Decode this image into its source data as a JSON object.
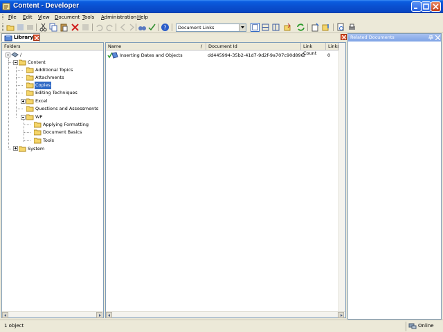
{
  "window": {
    "title": "Content - Developer"
  },
  "menu": [
    "File",
    "Edit",
    "View",
    "Document",
    "Tools",
    "Administration",
    "Help"
  ],
  "toolbar": {
    "document_links_select": "Document Links"
  },
  "library_tab": {
    "label": "Library"
  },
  "folders": {
    "header": "Folders",
    "tree": [
      {
        "label": "/",
        "level": 0
      },
      {
        "label": "Content",
        "level": 1
      },
      {
        "label": "Additional Topics",
        "level": 2
      },
      {
        "label": "Attachments",
        "level": 2
      },
      {
        "label": "Copies",
        "level": 2,
        "selected": true
      },
      {
        "label": "Editing Techniques",
        "level": 2
      },
      {
        "label": "Excel",
        "level": 2
      },
      {
        "label": "Questions and Assessments",
        "level": 2
      },
      {
        "label": "WP",
        "level": 2
      },
      {
        "label": "Applying Formatting",
        "level": 3
      },
      {
        "label": "Document Basics",
        "level": 3
      },
      {
        "label": "Tools",
        "level": 3
      },
      {
        "label": "System",
        "level": 1
      }
    ]
  },
  "documents": {
    "columns": [
      "Name",
      "Document Id",
      "Link Count",
      "Links"
    ],
    "rows": [
      {
        "name": "Inserting Dates and Objects",
        "id": "dd445994-35b2-41d7-9d2f-9a707c90d896",
        "link_count": "3",
        "links": "0"
      }
    ]
  },
  "related": {
    "title": "Related Documents"
  },
  "status": {
    "left": "1 object",
    "right": "Online"
  },
  "colors": {
    "title_bar": "#0A4FCF",
    "selection": "#316AC5",
    "chrome": "#ECE9D8"
  }
}
